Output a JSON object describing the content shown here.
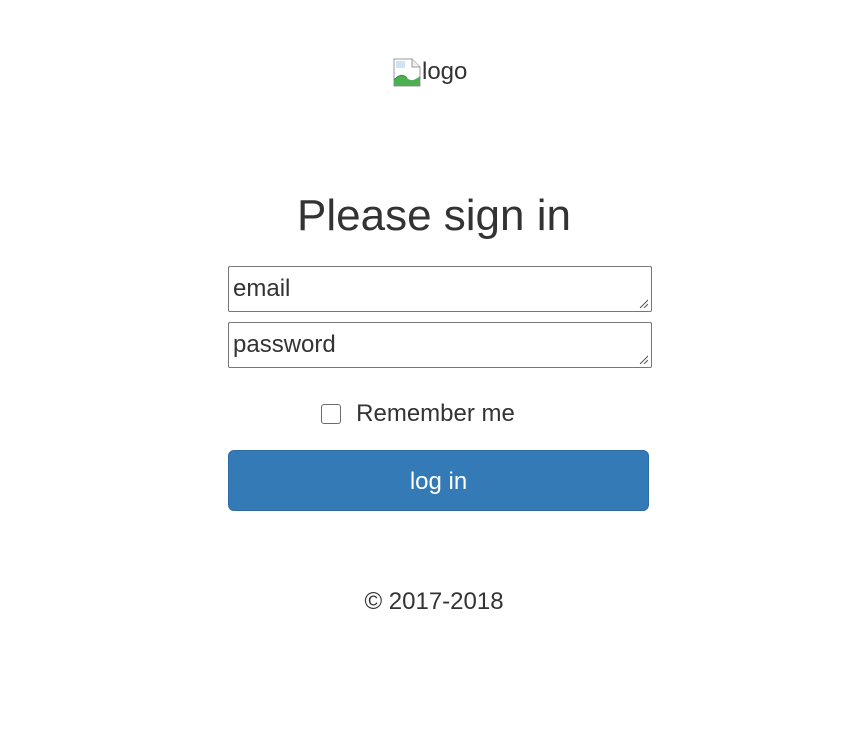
{
  "logo": {
    "alt_text": "logo",
    "icon": "broken-image-icon"
  },
  "form": {
    "title": "Please sign in",
    "email_value": "email",
    "password_value": "password",
    "remember_label": "Remember me",
    "remember_checked": false,
    "submit_label": "log in"
  },
  "footer": {
    "copyright": "© 2017-2018"
  },
  "colors": {
    "primary_button": "#337ab7",
    "text": "#333333",
    "background": "#ffffff"
  }
}
